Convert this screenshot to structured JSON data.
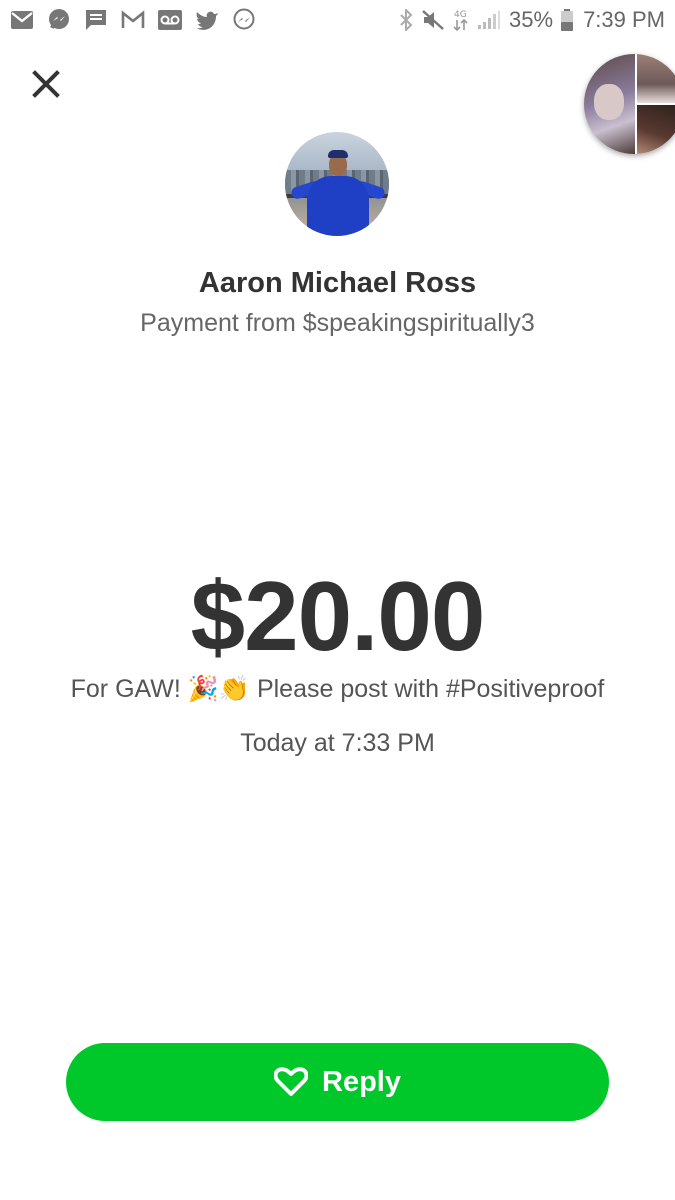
{
  "status_bar": {
    "left_icons": [
      "gmail-icon",
      "messenger-icon",
      "message-icon",
      "gmail-outline-icon",
      "voicemail-icon",
      "twitter-icon",
      "messenger-outline-icon"
    ],
    "right_icons": [
      "bluetooth-icon",
      "mute-icon",
      "data-4g-icon",
      "signal-icon",
      "battery-icon"
    ],
    "battery_percent": "35%",
    "time": "7:39 PM"
  },
  "payment": {
    "name": "Aaron Michael Ross",
    "subtitle": "Payment from $speakingspiritually3",
    "amount": "$20.00",
    "note": "For GAW! 🎉👏 Please post with #Positiveproof",
    "timestamp": "Today at 7:33 PM"
  },
  "actions": {
    "reply_label": "Reply"
  },
  "colors": {
    "reply_green": "#00c82a",
    "text_dark": "#333333",
    "text_muted": "#666666"
  }
}
